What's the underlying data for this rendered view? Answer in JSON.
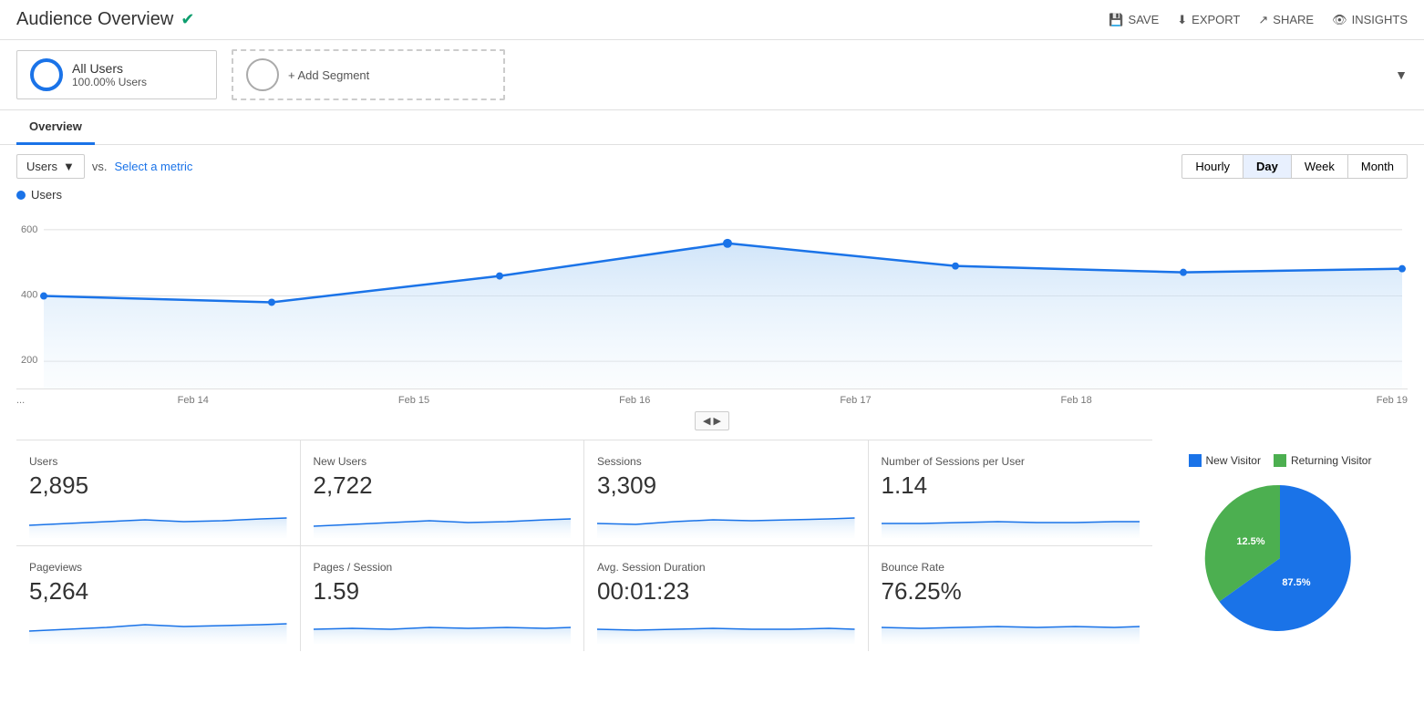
{
  "header": {
    "title": "Audience Overview",
    "verified_icon": "✔",
    "actions": [
      {
        "label": "SAVE",
        "icon": "💾"
      },
      {
        "label": "EXPORT",
        "icon": "⬇"
      },
      {
        "label": "SHARE",
        "icon": "↗"
      },
      {
        "label": "INSIGHTS",
        "icon": "👁"
      }
    ]
  },
  "segments": {
    "all_users_label": "All Users",
    "all_users_pct": "100.00% Users",
    "add_segment_label": "+ Add Segment"
  },
  "tabs": {
    "overview_label": "Overview"
  },
  "chart_controls": {
    "metric_label": "Users",
    "vs_label": "vs.",
    "select_metric_label": "Select a metric",
    "time_buttons": [
      "Hourly",
      "Day",
      "Week",
      "Month"
    ],
    "active_time_button": "Day"
  },
  "chart": {
    "legend_label": "Users",
    "y_labels": [
      "600",
      "400",
      "200"
    ],
    "x_labels": [
      "...",
      "Feb 14",
      "Feb 15",
      "Feb 16",
      "Feb 17",
      "Feb 18",
      "Feb 19"
    ],
    "range_label": "◀ ▶"
  },
  "metrics_row1": [
    {
      "label": "Users",
      "value": "2,895"
    },
    {
      "label": "New Users",
      "value": "2,722"
    },
    {
      "label": "Sessions",
      "value": "3,309"
    },
    {
      "label": "Number of Sessions per User",
      "value": "1.14"
    }
  ],
  "metrics_row2": [
    {
      "label": "Pageviews",
      "value": "5,264"
    },
    {
      "label": "Pages / Session",
      "value": "1.59"
    },
    {
      "label": "Avg. Session Duration",
      "value": "00:01:23"
    },
    {
      "label": "Bounce Rate",
      "value": "76.25%"
    }
  ],
  "pie_chart": {
    "new_visitor_label": "New Visitor",
    "returning_visitor_label": "Returning Visitor",
    "new_visitor_pct": "87.5%",
    "returning_visitor_pct": "12.5%",
    "new_visitor_color": "#1a73e8",
    "returning_visitor_color": "#4caf50"
  }
}
